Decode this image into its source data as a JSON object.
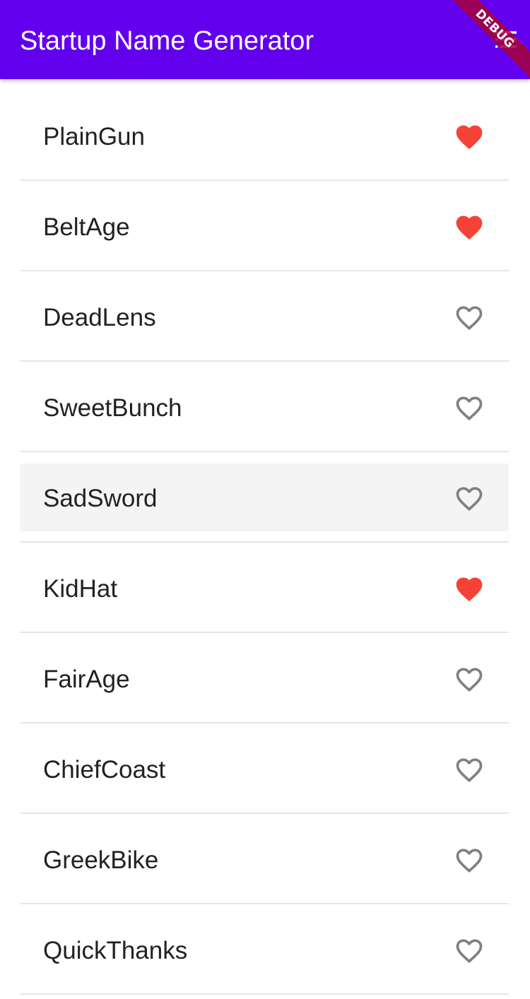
{
  "appbar": {
    "title": "Startup Name Generator",
    "action_icon": "list-icon",
    "background": "#6200ee"
  },
  "debug_banner": "DEBUG",
  "list": {
    "items": [
      {
        "name": "PlainGun",
        "favorite": true
      },
      {
        "name": "BeltAge",
        "favorite": true
      },
      {
        "name": "DeadLens",
        "favorite": false
      },
      {
        "name": "SweetBunch",
        "favorite": false
      },
      {
        "name": "SadSword",
        "favorite": false,
        "pressed": true
      },
      {
        "name": "KidHat",
        "favorite": true
      },
      {
        "name": "FairAge",
        "favorite": false
      },
      {
        "name": "ChiefCoast",
        "favorite": false
      },
      {
        "name": "GreekBike",
        "favorite": false
      },
      {
        "name": "QuickThanks",
        "favorite": false
      }
    ]
  },
  "colors": {
    "favorite": "#f44336",
    "not_favorite": "#808080"
  }
}
